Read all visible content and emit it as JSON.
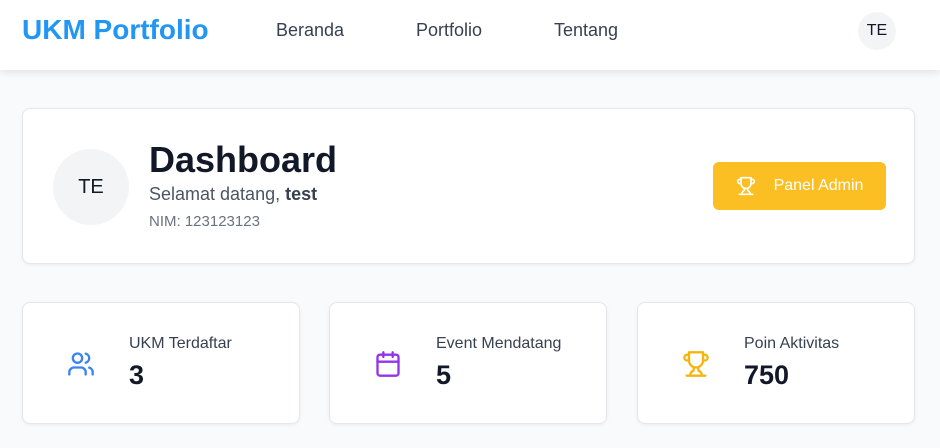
{
  "navbar": {
    "brand": "UKM Portfolio",
    "links": [
      {
        "label": "Beranda"
      },
      {
        "label": "Portfolio"
      },
      {
        "label": "Tentang"
      }
    ],
    "avatar_initials": "TE"
  },
  "profile": {
    "avatar_initials": "TE",
    "title": "Dashboard",
    "welcome_prefix": "Selamat datang, ",
    "username": "test",
    "nim": "NIM: 123123123",
    "admin_button_label": "Panel Admin"
  },
  "stats": [
    {
      "label": "UKM Terdaftar",
      "value": "3",
      "icon": "users-icon",
      "color": "#3b82f6"
    },
    {
      "label": "Event Mendatang",
      "value": "5",
      "icon": "calendar-icon",
      "color": "#9333ea"
    },
    {
      "label": "Poin Aktivitas",
      "value": "750",
      "icon": "trophy-icon",
      "color": "#f5b50a"
    }
  ],
  "colors": {
    "brand": "#2196f3",
    "admin_button": "#fbbf24",
    "background": "#f9fafb"
  }
}
